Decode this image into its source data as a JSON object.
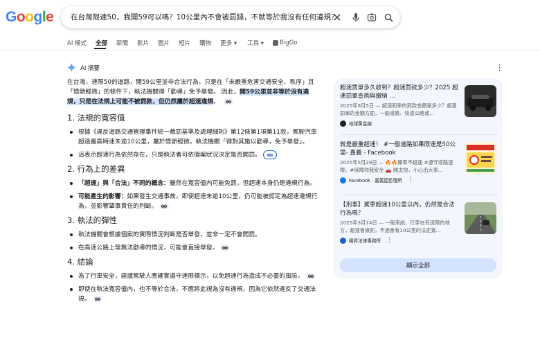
{
  "logo": {
    "letters": [
      "G",
      "o",
      "o",
      "g",
      "l",
      "e"
    ],
    "colors": [
      "#4285F4",
      "#EA4335",
      "#FBBC05",
      "#4285F4",
      "#34A853",
      "#EA4335"
    ]
  },
  "search": {
    "query": "在台灣限速50，我開59可以嗎？10公里內不會被罰錢，不就等於我沒有任何違規？"
  },
  "tabs": [
    {
      "label": "AI 模式",
      "active": false
    },
    {
      "label": "全部",
      "active": true
    },
    {
      "label": "新聞",
      "active": false
    },
    {
      "label": "影片",
      "active": false
    },
    {
      "label": "圖片",
      "active": false
    },
    {
      "label": "短片",
      "active": false
    },
    {
      "label": "購物",
      "active": false
    },
    {
      "label": "更多 ▾",
      "active": false
    },
    {
      "label": "工具 ▾",
      "active": false
    },
    {
      "label": "BigGo",
      "active": false
    }
  ],
  "ai": {
    "heading": "AI 摘要",
    "intro_1": "在台灣，速限50的道路，開59公里並非合法行為，只是在「未嚴重危害交通安全、秩序」且「情節輕微」的條件下，執法機關得「勸導」免予舉發。 因此，",
    "intro_hl": "開59公里並非等於沒有違規，只是在法規上可能不被罰款，但仍然屬於超速違規",
    "intro_2": "。",
    "sections": [
      {
        "title": "1. 法規的寬容值",
        "items": [
          {
            "bold": "",
            "text": "根據《違反道路交通管理事件統一裁罰基準及處理細則》第12條第1項第11款，駕駛汽車超過最高時速未逾10公里，屬於情節輕微，執法機關「得對其施以勸導，免予舉發」。",
            "chip": false
          },
          {
            "bold": "",
            "text": "這表示超速行為依然存在，只是執法者可依個案狀況決定是否開罰。",
            "chip": true
          }
        ]
      },
      {
        "title": "2. 行為上的差異",
        "items": [
          {
            "bold": "「超速」與「合法」不同的概念：",
            "text": "雖然在寬容值內可能免罰，但超速本身仍是違規行為。",
            "chip": false
          },
          {
            "bold": "可能產生的影響：",
            "text": "如果發生交通事故，即使超速未逾10公里，仍可能被認定為超速違規行為，並影響肇事責任的判斷。",
            "chip": true
          }
        ]
      },
      {
        "title": "3. 執法的彈性",
        "items": [
          {
            "bold": "",
            "text": "執法機關會根據個案的實際情況判斷是否舉發，並非一定不會開罰。",
            "chip": false
          },
          {
            "bold": "",
            "text": "在高速公路上等無法勸導的情況，可能會直接舉發。",
            "chip": true
          }
        ]
      },
      {
        "title": "4. 結論",
        "items": [
          {
            "bold": "",
            "text": "為了行車安全，建議駕駛人應確實遵守速限標示，以免超速行為造成不必要的風險。",
            "chip": true
          },
          {
            "bold": "",
            "text": "即使在執法寬容值內，也不等於合法，不應將此視為沒有違規，因為它依然違反了交通法規。",
            "chip": true
          }
        ]
      }
    ]
  },
  "sources": [
    {
      "title": "超速罰單多久收到？超速罰款多少？2025 超速罰單查詢與繳納 ...",
      "snippet": "2025年9月5日 — 超速罰單的罰款金額是多少？超速罰單的金額方面，一般道路、快速公路或...",
      "source": "地球黃金線",
      "icon_color": "#1f1f1f"
    },
    {
      "title": "就是嚴重超速！ #一般道路如果限速是50公里- 嘉義 - Facebook",
      "snippet": "2025年5月28日 — 🔥🔥開車不超速 #遵守道路速限，#保障你我安全 🚗 開太快，小心出大事...",
      "source": "Facebook · 嘉義區監理所",
      "icon_color": "#1877F2"
    },
    {
      "title": "【刑事】駕車超速10公里以內，仍然是合法行為嗎？",
      "snippet": "2025年3月14日 — 一般來說，行車在有速限的地方，超速會被罰，不過會有10公里的法定寬...",
      "source": "陽昇法律事務所",
      "icon_color": "#1a5fd1"
    }
  ],
  "show_all_label": "顯示全部"
}
